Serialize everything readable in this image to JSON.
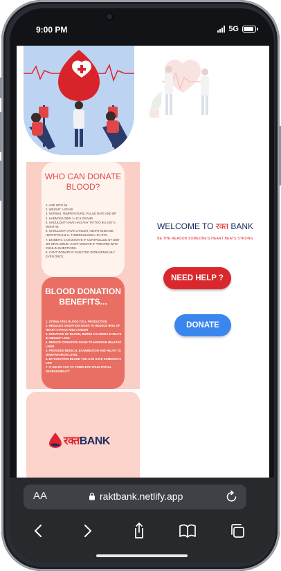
{
  "status": {
    "time": "9:00 PM",
    "network": "5G"
  },
  "page": {
    "who": {
      "title": "WHO CAN DONATE BLOOD?",
      "list": "1. AGE INTO 65\n2. WEIGHT > OR 60\n3. NORMAL TEMPERATURE, PULSE RATE AND BP\n4. HAEMOGLOBIN >=12.5 GRAMS\n5. SHOULDN'T HAVE HAD ANY TATTOO IN LAST 6 MONTHS\n6. SHOULDN'T HAVE CANCER, HEART DISEASE, HEPATITIS B & C, TUBERCULOSIS, HIV ETC.\n7. DIABETIC CAN DONATE IF CONTROLLED BY DIET OR ORAL DRUG. CAN'T DONATE IF TREATED WITH INSULIN INJECTIONS.\n8. CAN'T DONATE IF INJECTED INTRAVENOUSLY EVEN ONCE."
    },
    "benefits": {
      "title": "BLOOD DONATION BENEFITS...",
      "list": "1. STIMULATES BLOOD CELL PRODUCTION\n2. REDUCES OXIDATION SIGNS TO REDUCE RISK OF HEART ATTACK AND CANCER\n3. DONATION OF BLOOD, BURNS CALORIES & HELPS IN WEIGHT LOSS\n4. REDUCE OXIDATION SIGNS TO MAINTAIN HEALTHY LIVER\n5. PROVIDES MEDICAL EXAMINATION AND HELPS TO MAINTAIN IRON LEVEL\n6. BY DONATING BLOOD YOU CAN SAVE SOMEONE'S LIFE\n7. IT HELPS YOU TO COMPLETE YOUR SOCIAL RESPONSIBILITY"
    },
    "logo": {
      "text_hi": "रक्त",
      "text_en": "BANK"
    },
    "welcome": {
      "prefix": "WELCOME TO ",
      "brand_hi": "रक्त",
      "brand_en": " BANK"
    },
    "tagline": "BE THE REASON SOMEONE'S HEART BEATS STRONG",
    "help_label": "NEED HELP ?",
    "donate_label": "DONATE"
  },
  "browser": {
    "aa_label": "AA",
    "url": "raktbank.netlify.app"
  },
  "colors": {
    "accent_red": "#d9282d",
    "donate_blue": "#3b86ee",
    "navy": "#1f2d63"
  },
  "icons": [
    "lock-icon",
    "reload-icon",
    "back-icon",
    "forward-icon",
    "share-icon",
    "bookmarks-icon",
    "tabs-icon"
  ]
}
